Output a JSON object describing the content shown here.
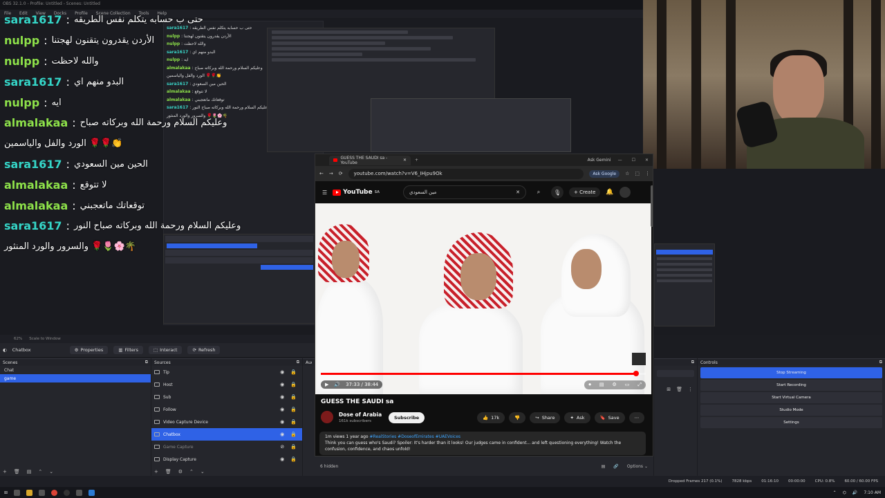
{
  "obs": {
    "title": "OBS 32.1.0 - Profile: Untitled - Scenes: Untitled",
    "menu": [
      "File",
      "Edit",
      "View",
      "Docks",
      "Profile",
      "Scene Collection",
      "Tools",
      "Help"
    ],
    "zoom": "62%",
    "scale_mode": "Scale to Window",
    "source_label": "Chatbox",
    "source_buttons": [
      "Properties",
      "Filters",
      "Interact",
      "Refresh"
    ],
    "docks": {
      "scenes": "Scenes",
      "sources": "Sources",
      "audio": "Audio",
      "controls": "Controls"
    },
    "scenes": [
      {
        "label": "Chat",
        "selected": false
      },
      {
        "label": "game",
        "selected": true
      }
    ],
    "sources": [
      {
        "label": "Tip",
        "selected": false,
        "dim": false
      },
      {
        "label": "Host",
        "selected": false,
        "dim": false
      },
      {
        "label": "Sub",
        "selected": false,
        "dim": false
      },
      {
        "label": "Follow",
        "selected": false,
        "dim": false
      },
      {
        "label": "Video Capture Device",
        "selected": false,
        "dim": false
      },
      {
        "label": "Chatbox",
        "selected": true,
        "dim": false
      },
      {
        "label": "Game Capture",
        "selected": false,
        "dim": true
      },
      {
        "label": "Display Capture",
        "selected": false,
        "dim": false
      }
    ],
    "audio_hidden": "6 hidden",
    "audio_options": "Options",
    "controls": [
      "Stop Streaming",
      "Start Recording",
      "Start Virtual Camera",
      "Studio Mode",
      "Settings"
    ],
    "status": {
      "dropped": "Dropped Frames 217 (0.1%)",
      "bitrate": "7828 kbps",
      "time": "01:16:10",
      "rec": "00:00:00",
      "cpu": "CPU: 0.8%",
      "fps": "60.00 / 60.00 FPS"
    }
  },
  "chat": [
    {
      "user": "sara1617",
      "kind": "sara",
      "msg": "حتى ب حسابه يتكلم نفس الطريقه"
    },
    {
      "user": "nulpp",
      "kind": "nulpp",
      "msg": "الأردن يقدرون يتقنون لهجتنا"
    },
    {
      "user": "nulpp",
      "kind": "nulpp",
      "msg": "والله لاحظت"
    },
    {
      "user": "sara1617",
      "kind": "sara",
      "msg": "البدو منهم اي"
    },
    {
      "user": "nulpp",
      "kind": "nulpp",
      "msg": "ايه"
    },
    {
      "user": "almalakaa",
      "kind": "alma",
      "msg": "وعليكم السلام ورحمة الله وبركاته صباح"
    },
    {
      "user": "",
      "kind": "cont",
      "msg": "الورد والفل والياسمين 🌹🌹👏"
    },
    {
      "user": "sara1617",
      "kind": "sara",
      "msg": "الحين مين السعودي"
    },
    {
      "user": "almalakaa",
      "kind": "alma",
      "msg": "لا تتوقع"
    },
    {
      "user": "almalakaa",
      "kind": "alma",
      "msg": "توقعاتك ماتعجبني"
    },
    {
      "user": "sara1617",
      "kind": "sara",
      "msg": "وعليكم السلام ورحمة الله وبركاته صباح النور"
    },
    {
      "user": "",
      "kind": "cont",
      "msg": "والسرور والورد المنثور 🌹🌷🌸🌴"
    }
  ],
  "browser": {
    "tab_title": "GUESS THE SAUDI sa - YouTube",
    "ask_gemini": "Ask Gemini",
    "url": "youtube.com/watch?v=V6_IHjpu9Ok",
    "ask_google": "Ask Google",
    "yt_logo": "YouTube",
    "yt_region": "SA",
    "search_query": "مين السعودي",
    "create": "Create",
    "time": "37:33 / 38:44",
    "video_title": "GUESS THE SAUDI sa",
    "channel": "Dose of Arabia",
    "subs": "161k subscribers",
    "subscribe": "Subscribe",
    "likes": "17k",
    "share": "Share",
    "ask": "Ask",
    "save": "Save",
    "views": "1m views  1 year ago",
    "hashtags": "#RealStories #DoseofEmirates #UAEVoices",
    "description": "Think you can guess who's Saudi? Spoiler: It's harder than it looks! Our judges came in confident... and left questioning everything! Watch the confusion, confidence, and chaos unfold!",
    "progress": 0.97
  },
  "taskbar": {
    "clock": "7:10 AM"
  },
  "colors": {
    "accent": "#2f62e6",
    "sara": "#35d6c8",
    "green": "#8ee24a",
    "yt_red": "#ff0000"
  }
}
